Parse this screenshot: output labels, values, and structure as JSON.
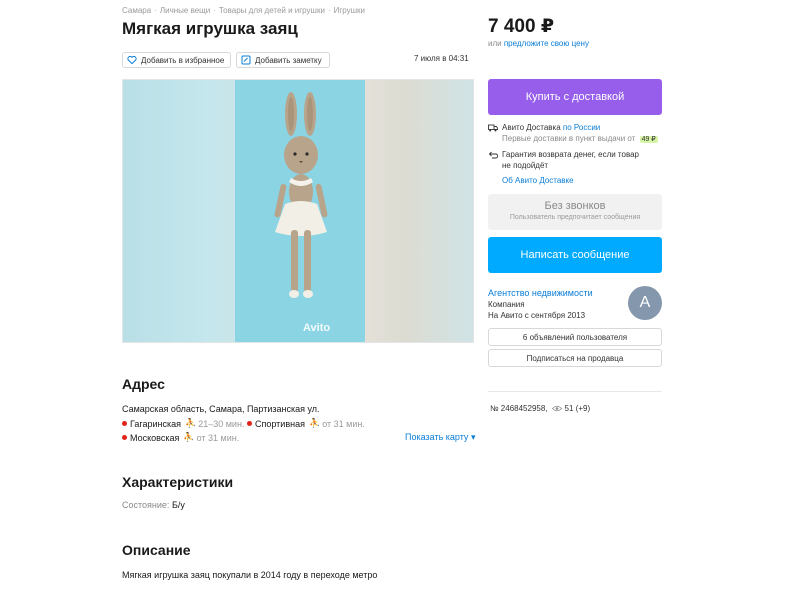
{
  "breadcrumbs": [
    "Самара",
    "Личные вещи",
    "Товары для детей и игрушки",
    "Игрушки"
  ],
  "title": "Мягкая игрушка заяц",
  "actions": {
    "favorite_label": "Добавить в избранное",
    "note_label": "Добавить заметку",
    "date": "7 июля в 04:31"
  },
  "gallery": {
    "watermark": "Avito"
  },
  "address": {
    "heading": "Адрес",
    "text": "Самарская область, Самара, Партизанская ул.",
    "metro": [
      {
        "station": "Гагаринская",
        "walk": "21–30 мин."
      },
      {
        "station": "Спортивная",
        "walk": "от 31 мин."
      },
      {
        "station": "Московская",
        "walk": "от 31 мин."
      }
    ],
    "show_map": "Показать карту"
  },
  "characteristics": {
    "heading": "Характеристики",
    "label": "Состояние:",
    "value": "Б/у"
  },
  "description": {
    "heading": "Описание",
    "text": "Мягкая игрушка заяц покупали в 2014 году в переходе метро"
  },
  "price": {
    "value": "7 400 ₽",
    "or_text": "или",
    "offer_link": "предложите свою цену"
  },
  "buy_button": "Купить с доставкой",
  "delivery": {
    "title": "Авито Доставка",
    "region": "по России",
    "first_delivery": "Первые доставки в пункт выдачи от",
    "price_tag": "49 ₽",
    "guarantee_line1": "Гарантия возврата денег, если товар",
    "guarantee_line2": "не подойдёт",
    "about_link": "Об Авито Доставке"
  },
  "no_calls": {
    "title": "Без звонков",
    "subtitle": "Пользователь предпочитает сообщения"
  },
  "message_button": "Написать сообщение",
  "seller": {
    "name": "Агентство недвижимости",
    "type": "Компания",
    "since": "На Авито с сентября 2013",
    "avatar_letter": "А",
    "ads_button": "6 объявлений пользователя",
    "subscribe_button": "Подписаться на продавца"
  },
  "ad_meta": {
    "number": "№ 2468452958,",
    "views": "51 (+9)"
  },
  "colors": {
    "buy": "#965eeb",
    "message": "#00aaff",
    "link": "#0a7dd6",
    "metro_red": "#e2231a",
    "avatar": "#8497ad"
  },
  "icons": [
    "heart-icon",
    "note-icon",
    "truck-icon",
    "return-icon",
    "eye-icon",
    "walk-icon"
  ]
}
